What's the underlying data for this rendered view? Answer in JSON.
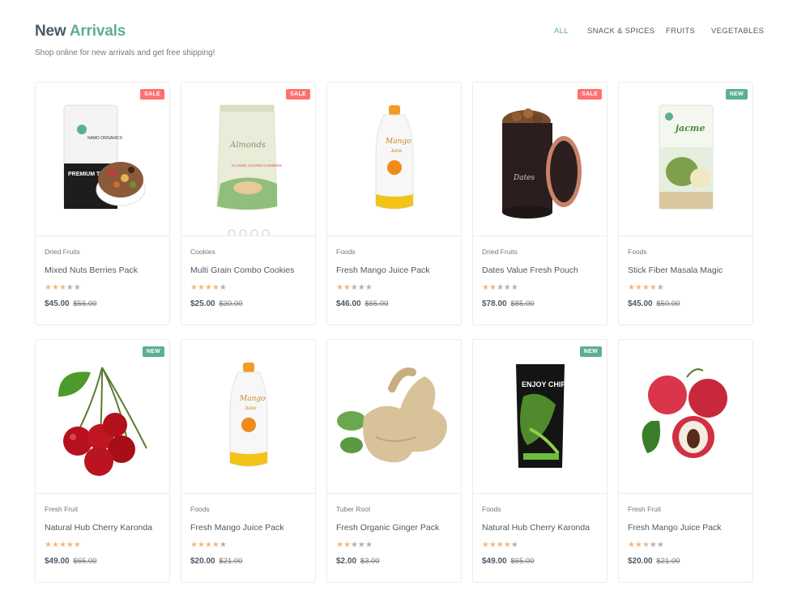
{
  "section": {
    "title_main": "New",
    "title_accent": "Arrivals",
    "subtitle": "Shop online for new arrivals and get free shipping!"
  },
  "filters": [
    {
      "label": "ALL",
      "active": true
    },
    {
      "label": "SNACK & SPICES",
      "active": false
    },
    {
      "label": "FRUITS",
      "active": false
    },
    {
      "label": "VEGETABLES",
      "active": false
    }
  ],
  "colors": {
    "accent": "#5caf90",
    "sale": "#ff7070",
    "text": "#4b5966"
  },
  "products": [
    {
      "category": "Dried Fruits",
      "name": "Mixed Nuts Berries Pack",
      "rating": 3,
      "price": "$45.00",
      "old_price": "$56.00",
      "badge": "SALE",
      "image": "trail-mix-pouch"
    },
    {
      "category": "Cookies",
      "name": "Multi Grain Combo Cookies",
      "rating": 4,
      "price": "$25.00",
      "old_price": "$30.00",
      "badge": "SALE",
      "image": "almonds-pouch"
    },
    {
      "category": "Foods",
      "name": "Fresh Mango Juice Pack",
      "rating": 2,
      "price": "$46.00",
      "old_price": "$65.00",
      "badge": "",
      "image": "mango-juice-pouch"
    },
    {
      "category": "Dried Fruits",
      "name": "Dates Value Fresh Pouch",
      "rating": 2,
      "price": "$78.00",
      "old_price": "$85.00",
      "badge": "SALE",
      "image": "dates-tin"
    },
    {
      "category": "Foods",
      "name": "Stick Fiber Masala Magic",
      "rating": 4,
      "price": "$45.00",
      "old_price": "$50.00",
      "badge": "NEW",
      "image": "jackfruit-pouch"
    },
    {
      "category": "Fresh Fruit",
      "name": "Natural Hub Cherry Karonda",
      "rating": 5,
      "price": "$49.00",
      "old_price": "$65.00",
      "badge": "NEW",
      "image": "cherries"
    },
    {
      "category": "Foods",
      "name": "Fresh Mango Juice Pack",
      "rating": 4,
      "price": "$20.00",
      "old_price": "$21.00",
      "badge": "",
      "image": "mango-juice-pouch"
    },
    {
      "category": "Tuber Root",
      "name": "Fresh Organic Ginger Pack",
      "rating": 2,
      "price": "$2.00",
      "old_price": "$3.00",
      "badge": "",
      "image": "ginger"
    },
    {
      "category": "Foods",
      "name": "Natural Hub Cherry Karonda",
      "rating": 4,
      "price": "$49.00",
      "old_price": "$65.00",
      "badge": "NEW",
      "image": "chips-pack"
    },
    {
      "category": "Fresh Fruit",
      "name": "Fresh Mango Juice Pack",
      "rating": 3,
      "price": "$20.00",
      "old_price": "$21.00",
      "badge": "",
      "image": "lychees"
    }
  ],
  "image_text": {
    "trail_mix": {
      "brand": "NAMO ORGANICS",
      "label": "PREMIUM TRAIL MIX"
    },
    "almonds": {
      "label": "Almonds",
      "sub": "CLASSIC SALTED CASHEWS"
    },
    "mango": {
      "label": "Mango",
      "sub": "Juice"
    },
    "dates": {
      "label": "Dates"
    },
    "jackfruit": {
      "label": "jacme"
    },
    "chips": {
      "label": "ENJOY CHIPS"
    }
  }
}
